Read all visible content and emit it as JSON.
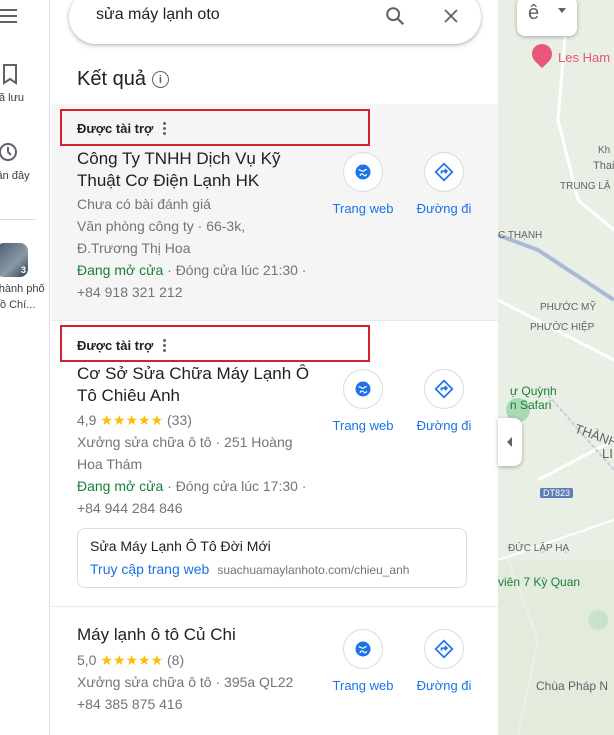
{
  "rail": {
    "saved_label": "Đã lưu",
    "recent_label": "Gần đây",
    "recent_place_line1": "Thành phố",
    "recent_place_line2": "Hồ Chí..."
  },
  "search": {
    "query": "sửa máy lạnh oto"
  },
  "results": {
    "title": "Kết quả"
  },
  "cards": [
    {
      "sponsored_label": "Được tài trợ",
      "name_line1": "Công Ty TNHH Dịch Vụ Kỹ",
      "name_line2": "Thuật Cơ Điện Lạnh HK",
      "rating_text": "Chưa có bài đánh giá",
      "address_line1": "Văn phòng công ty · 66-3k,",
      "address_line2": "Đ.Trương Thị Hoa",
      "open_status": "Đang mở cửa",
      "closing": " · Đóng cửa lúc 21:30 ·",
      "phone": "+84 918 321 212",
      "website_label": "Trang web",
      "directions_label": "Đường đi"
    },
    {
      "sponsored_label": "Được tài trợ",
      "name_line1": "Cơ Sở Sửa Chữa Máy Lạnh Ô",
      "name_line2": "Tô Chiêu Anh",
      "rating": "4,9",
      "stars": "★★★★★",
      "review_count": "(33)",
      "address_line1": "Xưởng sửa chữa ô tô · 251 Hoàng",
      "address_line2": "Hoa Thám",
      "open_status": "Đang mở cửa",
      "closing": " · Đóng cửa lúc 17:30 ·",
      "phone": "+84 944 284 846",
      "ad_title": "Sửa Máy Lạnh Ô Tô Đời Mới",
      "ad_link": "Truy cập trang web",
      "ad_url": "suachuamaylanhoto.com/chieu_anh",
      "website_label": "Trang web",
      "directions_label": "Đường đi"
    },
    {
      "name_line1": "Máy lạnh ô tô Củ Chi",
      "rating": "5,0",
      "stars": "★★★★★",
      "review_count": "(8)",
      "address_line1": "Xưởng sửa chữa ô tô · 395a QL22",
      "phone": "+84 385 875 416",
      "website_label": "Trang web",
      "directions_label": "Đường đi"
    }
  ],
  "map": {
    "labels": [
      "Les Ham",
      "Kh",
      "Thai C",
      "TRUNG LẬ",
      "C THẠNH",
      "PHƯỚC MỸ",
      "PHƯỚC HIỆP",
      "ự Quỳnh",
      "n Safari",
      "THÀNH",
      "LI",
      "DT823",
      "ĐỨC LẬP HẠ",
      "viên 7 Kỳ Quan",
      "Chùa Pháp N"
    ],
    "colors": {
      "water": "#a8dab5",
      "road": "#aab9d6",
      "land": "#e9efe4"
    }
  }
}
